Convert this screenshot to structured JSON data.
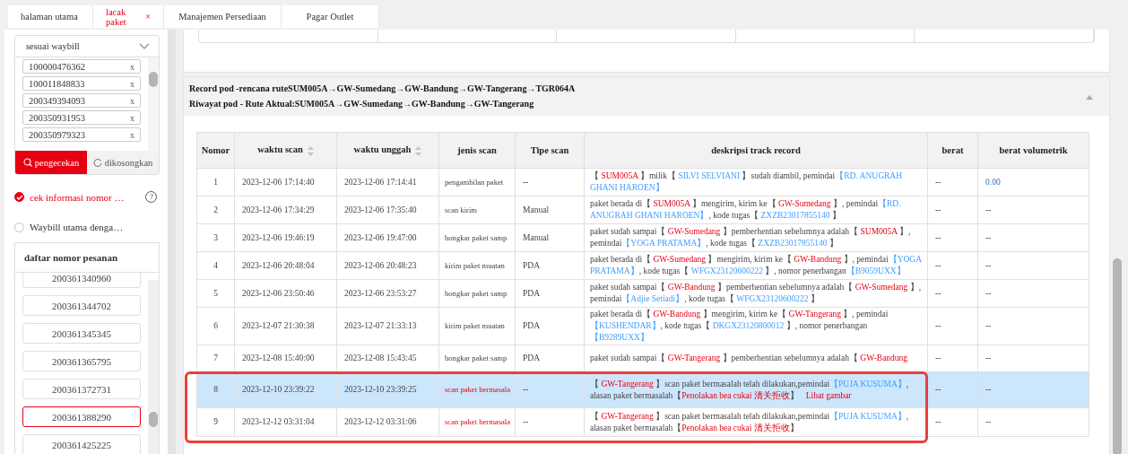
{
  "tabs": [
    {
      "label": "halaman utama",
      "selected": false,
      "closable": false
    },
    {
      "label": "lacak paket",
      "selected": true,
      "closable": true
    },
    {
      "label": "Manajemen Persediaan",
      "selected": false,
      "closable": false
    },
    {
      "label": "Pagar Outlet",
      "selected": false,
      "closable": false
    }
  ],
  "close_glyph": "×",
  "sidebar": {
    "query_type": "sesuai waybill",
    "waybills": [
      {
        "number": "100000476362",
        "remove": "x"
      },
      {
        "number": "100011848833",
        "remove": "x"
      },
      {
        "number": "200349394093",
        "remove": "x"
      },
      {
        "number": "200350931953",
        "remove": "x"
      },
      {
        "number": "200350979323",
        "remove": "x"
      }
    ],
    "search_button": "pengecekan",
    "clear_button": "dikosongkan",
    "options": [
      {
        "label": "cek informasi nomor …",
        "checked": true,
        "help": true
      },
      {
        "label": "Waybill utama denga…",
        "checked": false,
        "help": false
      }
    ],
    "help_glyph": "?",
    "orders_title": "daftar nomor pesanan",
    "orders": [
      {
        "number": "200361340960",
        "selected": false
      },
      {
        "number": "200361344702",
        "selected": false
      },
      {
        "number": "200361345345",
        "selected": false
      },
      {
        "number": "200361365795",
        "selected": false
      },
      {
        "number": "200361372731",
        "selected": false
      },
      {
        "number": "200361388290",
        "selected": true
      },
      {
        "number": "200361425225",
        "selected": false
      }
    ]
  },
  "route": {
    "planned": "Record pod -rencana ruteSUM005A→GW-Sumedang→GW-Bandung→GW-Tangerang→TGR064A",
    "actual": "Riwayat pod - Rute Aktual:SUM005A→GW-Sumedang→GW-Bandung→GW-Tangerang",
    "expanded": true
  },
  "table": {
    "columns": [
      {
        "label": "Nomor",
        "sortable": false
      },
      {
        "label": "waktu scan",
        "sortable": true
      },
      {
        "label": "waktu unggah",
        "sortable": true
      },
      {
        "label": "jenis scan",
        "sortable": false
      },
      {
        "label": "Tipe scan",
        "sortable": false
      },
      {
        "label": "deskripsi track record",
        "sortable": false
      },
      {
        "label": "berat",
        "sortable": false
      },
      {
        "label": "berat volumetrik",
        "sortable": false
      }
    ],
    "rows": [
      {
        "no": "1",
        "scan_time": "2023-12-06 17:14:40",
        "upload_time": "2023-12-06 17:14:41",
        "scan_kind": "pengambilan paket",
        "problem": false,
        "scan_type": "--",
        "selected": false,
        "weight": "--",
        "volumetric": "0.00",
        "link": null,
        "description": [
          {
            "kind": "text",
            "text": "【 "
          },
          {
            "kind": "place",
            "text": "SUM005A"
          },
          {
            "kind": "text",
            "text": " 】milik【 "
          },
          {
            "kind": "person",
            "text": "SILVI SELVIANI"
          },
          {
            "kind": "text",
            "text": " 】sudah diambil,  pemindai"
          },
          {
            "kind": "person",
            "text": "【RD. ANUGRAH GHANI HAROEN】"
          }
        ]
      },
      {
        "no": "2",
        "scan_time": "2023-12-06 17:34:29",
        "upload_time": "2023-12-06 17:35:40",
        "scan_kind": "scan kirim",
        "problem": false,
        "scan_type": "Manual",
        "selected": false,
        "weight": "--",
        "volumetric": "--",
        "link": null,
        "description": [
          {
            "kind": "text",
            "text": "paket berada di【 "
          },
          {
            "kind": "place",
            "text": "SUM005A"
          },
          {
            "kind": "text",
            "text": " 】mengirim, kirim ke【 "
          },
          {
            "kind": "place",
            "text": "GW-Sumedang"
          },
          {
            "kind": "text",
            "text": " 】,  pemindai"
          },
          {
            "kind": "person",
            "text": "【RD. ANUGRAH GHANI HAROEN】"
          },
          {
            "kind": "text",
            "text": ",  kode tugas【 "
          },
          {
            "kind": "person",
            "text": "ZXZB23017855140"
          },
          {
            "kind": "text",
            "text": " 】"
          }
        ]
      },
      {
        "no": "3",
        "scan_time": "2023-12-06 19:46:19",
        "upload_time": "2023-12-06 19:47:00",
        "scan_kind": "bongkar paket samp",
        "problem": false,
        "scan_type": "Manual",
        "selected": false,
        "weight": "--",
        "volumetric": "--",
        "link": null,
        "description": [
          {
            "kind": "text",
            "text": "paket sudah sampai【 "
          },
          {
            "kind": "place",
            "text": "GW-Sumedang"
          },
          {
            "kind": "text",
            "text": " 】pemberhentian sebelumnya adalah【 "
          },
          {
            "kind": "place",
            "text": "SUM005A"
          },
          {
            "kind": "text",
            "text": " 】,  pemindai"
          },
          {
            "kind": "person",
            "text": "【YOGA PRATAMA】"
          },
          {
            "kind": "text",
            "text": ",  kode tugas【 "
          },
          {
            "kind": "person",
            "text": "ZXZB23017855140"
          },
          {
            "kind": "text",
            "text": " 】"
          }
        ]
      },
      {
        "no": "4",
        "scan_time": "2023-12-06 20:48:04",
        "upload_time": "2023-12-06 20:48:23",
        "scan_kind": "kirim paket muatan",
        "problem": false,
        "scan_type": "PDA",
        "selected": false,
        "weight": "--",
        "volumetric": "--",
        "link": null,
        "description": [
          {
            "kind": "text",
            "text": "paket berada di【 "
          },
          {
            "kind": "place",
            "text": "GW-Sumedang"
          },
          {
            "kind": "text",
            "text": " 】mengirim, kirim ke【 "
          },
          {
            "kind": "place",
            "text": "GW-Bandung"
          },
          {
            "kind": "text",
            "text": " 】,  pemindai"
          },
          {
            "kind": "person",
            "text": "【YOGA PRATAMA】"
          },
          {
            "kind": "text",
            "text": ",  kode tugas【 "
          },
          {
            "kind": "person",
            "text": "WFGX23120600222"
          },
          {
            "kind": "text",
            "text": " 】,  nomor penerbangan"
          },
          {
            "kind": "person",
            "text": "【B9059UXX】"
          }
        ]
      },
      {
        "no": "5",
        "scan_time": "2023-12-06 23:50:46",
        "upload_time": "2023-12-06 23:53:27",
        "scan_kind": "bongkar paket samp",
        "problem": false,
        "scan_type": "PDA",
        "selected": false,
        "weight": "--",
        "volumetric": "--",
        "link": null,
        "description": [
          {
            "kind": "text",
            "text": "paket sudah sampai【 "
          },
          {
            "kind": "place",
            "text": "GW-Bandung"
          },
          {
            "kind": "text",
            "text": " 】pemberhentian sebelumnya adalah【 "
          },
          {
            "kind": "place",
            "text": "GW-Sumedang"
          },
          {
            "kind": "text",
            "text": " 】,  pemindai"
          },
          {
            "kind": "person",
            "text": "【Adjie Setiadi】"
          },
          {
            "kind": "text",
            "text": ",  kode tugas【 "
          },
          {
            "kind": "person",
            "text": "WFGX23120600222"
          },
          {
            "kind": "text",
            "text": " 】"
          }
        ]
      },
      {
        "no": "6",
        "scan_time": "2023-12-07 21:30:38",
        "upload_time": "2023-12-07 21:33:13",
        "scan_kind": "kirim paket muatan",
        "problem": false,
        "scan_type": "PDA",
        "selected": false,
        "weight": "--",
        "volumetric": "--",
        "link": null,
        "description": [
          {
            "kind": "text",
            "text": "paket berada di【 "
          },
          {
            "kind": "place",
            "text": "GW-Bandung"
          },
          {
            "kind": "text",
            "text": " 】mengirim, kirim ke【 "
          },
          {
            "kind": "place",
            "text": "GW-Tangerang"
          },
          {
            "kind": "text",
            "text": " 】,  pemindai"
          },
          {
            "kind": "person",
            "text": "【KUSHENDAR】"
          },
          {
            "kind": "text",
            "text": ",  kode tugas【 "
          },
          {
            "kind": "person",
            "text": "DKGX23120800012"
          },
          {
            "kind": "text",
            "text": " 】,  nomor penerbangan"
          },
          {
            "kind": "person",
            "text": "【B9289UXX】"
          }
        ]
      },
      {
        "no": "7",
        "scan_time": "2023-12-08 15:40:00",
        "upload_time": "2023-12-08 15:43:45",
        "scan_kind": "bongkar paket samp",
        "problem": false,
        "scan_type": "PDA",
        "selected": false,
        "weight": "--",
        "volumetric": "--",
        "link": null,
        "description": [
          {
            "kind": "text",
            "text": "paket sudah sampai【 "
          },
          {
            "kind": "place",
            "text": "GW-Tangerang"
          },
          {
            "kind": "text",
            "text": " 】pemberhentian sebelumnya adalah【 "
          },
          {
            "kind": "place",
            "text": "GW-Bandung"
          }
        ]
      },
      {
        "no": "8",
        "scan_time": "2023-12-10 23:39:22",
        "upload_time": "2023-12-10 23:39:25",
        "scan_kind": "scan paket bermasala",
        "problem": true,
        "scan_type": "--",
        "selected": true,
        "weight": "--",
        "volumetric": "--",
        "link": "Lihat gambar",
        "description": [
          {
            "kind": "text",
            "text": "【 "
          },
          {
            "kind": "place",
            "text": "GW-Tangerang"
          },
          {
            "kind": "text",
            "text": " 】scan paket bermasalah telah dilakukan,pemindai"
          },
          {
            "kind": "person",
            "text": "【PUJA KUSUMA】"
          },
          {
            "kind": "text",
            "text": ",  alasan paket bermasalah【"
          },
          {
            "kind": "place",
            "text": "Penolakan bea cukai 清关拒收"
          },
          {
            "kind": "text",
            "text": "】"
          }
        ]
      },
      {
        "no": "9",
        "scan_time": "2023-12-12 03:31:04",
        "upload_time": "2023-12-12 03:31:06",
        "scan_kind": "scan paket bermasala",
        "problem": true,
        "scan_type": "--",
        "selected": false,
        "weight": "--",
        "volumetric": "--",
        "link": null,
        "description": [
          {
            "kind": "text",
            "text": "【 "
          },
          {
            "kind": "place",
            "text": "GW-Tangerang"
          },
          {
            "kind": "text",
            "text": " 】scan paket bermasalah telah dilakukan,pemindai"
          },
          {
            "kind": "person",
            "text": "【PUJA KUSUMA】"
          },
          {
            "kind": "text",
            "text": ",  alasan paket bermasalah【"
          },
          {
            "kind": "place",
            "text": "Penolakan bea cukai 清关拒收"
          },
          {
            "kind": "text",
            "text": "】"
          }
        ]
      }
    ]
  }
}
